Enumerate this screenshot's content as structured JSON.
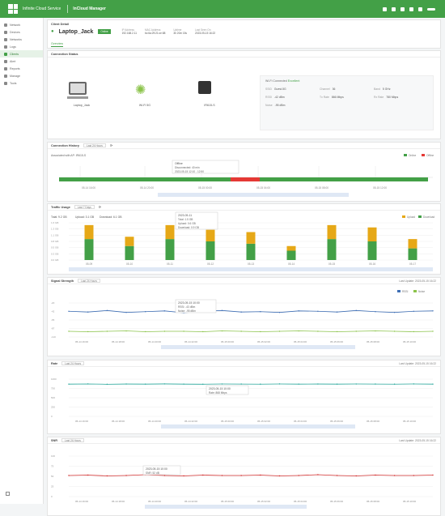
{
  "topbar": {
    "app_title": "Infinite Cloud Service",
    "product": "InCloud Manager"
  },
  "sidebar": {
    "items": [
      "Network",
      "Devices",
      "Networks",
      "Logs",
      "Clients",
      "Alert",
      "Reports",
      "Manage",
      "Tools"
    ],
    "active_index": 4
  },
  "client": {
    "section_title": "Client Detail",
    "name": "Laptop_Jack",
    "status": "Online",
    "meta": [
      {
        "label": "IP Address",
        "value": "192.168.2.11"
      },
      {
        "label": "MAC Address",
        "value": "bc:6a:29:21:ce:88"
      },
      {
        "label": "Uptime",
        "value": "3h 20m 15s"
      },
      {
        "label": "Last Seen On",
        "value": "2023-05-15 16:22"
      }
    ],
    "tab": "Overview"
  },
  "connection": {
    "title": "Connection Status",
    "nodes": [
      {
        "label": "Laptop_Jack",
        "icon": "laptop-icon"
      },
      {
        "label": "Wi-Fi 5G",
        "icon": "wifi-icon"
      },
      {
        "label": "IR615-S",
        "icon": "router-icon"
      }
    ],
    "details_title": "Wi-Fi Connected",
    "details_badge": "Excellent",
    "details": [
      {
        "k": "SSID",
        "v": "Guest-5G"
      },
      {
        "k": "Channel",
        "v": "36"
      },
      {
        "k": "Band",
        "v": "5 GHz"
      },
      {
        "k": "RSSI",
        "v": "-42 dBm"
      },
      {
        "k": "Tx Rate",
        "v": "866 Mbps"
      },
      {
        "k": "Rx Rate",
        "v": "780 Mbps"
      },
      {
        "k": "Noise",
        "v": "-95 dBm"
      }
    ]
  },
  "conn_history": {
    "title": "Connection History",
    "range": "Last 24 Hours",
    "subtitle": "Associated with AP: IR615-S",
    "legend": [
      "Online",
      "Offline"
    ],
    "tooltip_title": "Offline",
    "tooltip_lines": [
      "Disconnected: 40 min",
      "2023-05-15 12:10 - 12:50"
    ],
    "ticks": [
      "05-14 16:00",
      "05-14 20:00",
      "05-15 00:00",
      "05-15 04:00",
      "05-15 08:00",
      "05-15 12:00"
    ]
  },
  "traffic": {
    "title": "Traffic Usage",
    "range": "Last 7 Days",
    "totals": [
      {
        "label": "Total",
        "value": "9.2 GB"
      },
      {
        "label": "Upload",
        "value": "3.1 GB"
      },
      {
        "label": "Download",
        "value": "6.1 GB"
      }
    ],
    "tooltip_date": "2023-05-11",
    "tooltip_lines": [
      "Total: 1.5 GB",
      "Upload: 0.6 GB",
      "Download: 0.9 GB"
    ],
    "legend": [
      "Upload",
      "Download"
    ]
  },
  "signal": {
    "title": "Signal Strength",
    "range": "Last 24 Hours",
    "right_label": "Last Update: 2023-05-15 16:22",
    "legend": [
      "RSSI",
      "Noise"
    ],
    "tooltip_title": "2023-05-15 10:00",
    "tooltip_lines": [
      "RSSI: -43 dBm",
      "Noise: -95 dBm"
    ]
  },
  "rate": {
    "title": "Rate",
    "range": "Last 24 Hours",
    "right_label": "Last Update: 2023-05-15 16:22",
    "tooltip_title": "2023-05-15 10:00",
    "tooltip_lines": [
      "Rate: 868 Mbps"
    ]
  },
  "snr": {
    "title": "SNR",
    "range": "Last 24 Hours",
    "right_label": "Last Update: 2023-05-15 16:22",
    "tooltip_title": "2023-05-15 10:00",
    "tooltip_lines": [
      "SNR: 52 dB"
    ]
  },
  "chart_data": [
    {
      "type": "bar",
      "title": "Traffic Usage",
      "categories": [
        "05-09",
        "05-10",
        "05-11",
        "05-12",
        "05-13",
        "05-14",
        "05-15",
        "05-16",
        "05-17"
      ],
      "series": [
        {
          "name": "Download",
          "values": [
            0.9,
            0.6,
            0.9,
            0.8,
            0.7,
            0.4,
            0.9,
            0.8,
            0.5
          ],
          "color": "#43a047"
        },
        {
          "name": "Upload",
          "values": [
            0.6,
            0.4,
            0.6,
            0.5,
            0.5,
            0.2,
            0.6,
            0.6,
            0.4
          ],
          "color": "#e6a817"
        }
      ],
      "ylim": [
        0,
        1.6
      ]
    },
    {
      "type": "line",
      "title": "Signal Strength",
      "series": [
        {
          "name": "RSSI",
          "values": [
            -42,
            -44,
            -40,
            -45,
            -43,
            -41,
            -46,
            -42,
            -40,
            -44,
            -43,
            -45,
            -41,
            -42,
            -44,
            -40,
            -43,
            -45,
            -42,
            -41
          ],
          "color": "#3f6fb5"
        },
        {
          "name": "Noise",
          "values": [
            -95,
            -96,
            -95,
            -94,
            -96,
            -95,
            -95,
            -96,
            -94,
            -95,
            -96,
            -95,
            -94,
            -95,
            -96,
            -95,
            -94,
            -95,
            -96,
            -95
          ],
          "color": "#8bc34a"
        }
      ],
      "ylim": [
        -110,
        -20
      ]
    },
    {
      "type": "line",
      "title": "Rate",
      "series": [
        {
          "name": "Rate",
          "values": [
            866,
            870,
            862,
            868,
            865,
            871,
            866,
            863,
            869,
            867,
            864,
            870,
            866,
            868,
            865,
            869,
            867,
            864,
            870,
            866
          ],
          "color": "#26a69a"
        }
      ],
      "ylim": [
        0,
        1000
      ]
    },
    {
      "type": "line",
      "title": "SNR",
      "series": [
        {
          "name": "SNR",
          "values": [
            52,
            53,
            51,
            52,
            54,
            52,
            51,
            53,
            52,
            52,
            53,
            51,
            52,
            54,
            52,
            51,
            53,
            52,
            52,
            53
          ],
          "color": "#d32f2f"
        }
      ],
      "ylim": [
        0,
        100
      ]
    }
  ]
}
